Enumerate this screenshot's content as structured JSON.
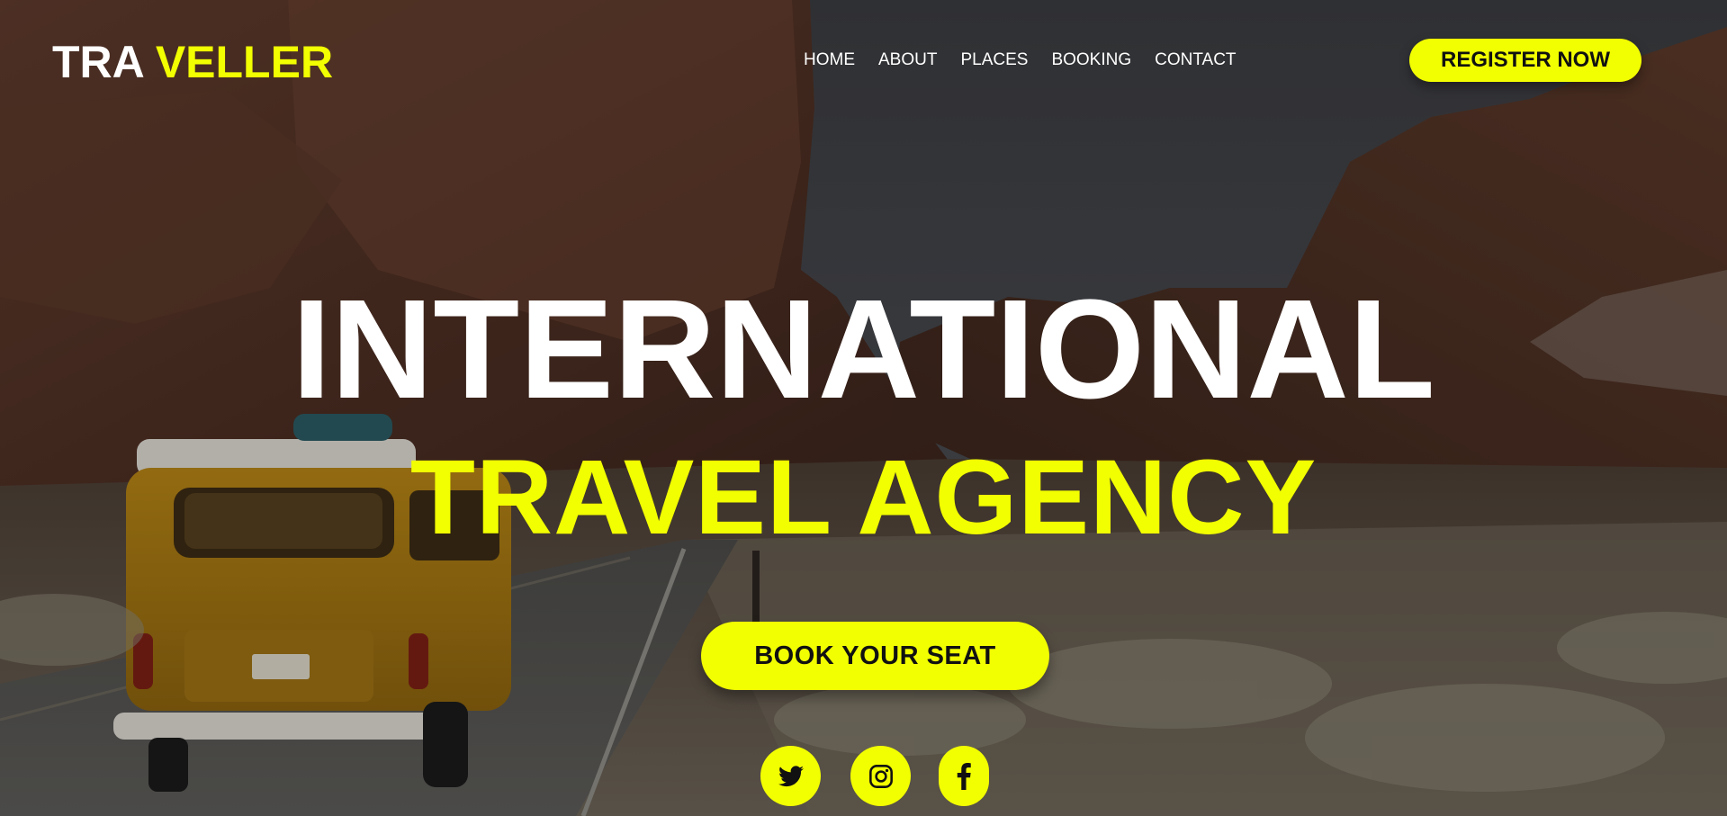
{
  "logo": {
    "part1": "TRA",
    "part2": "VELLER"
  },
  "nav": {
    "items": [
      {
        "label": "HOME"
      },
      {
        "label": "ABOUT"
      },
      {
        "label": "PLACES"
      },
      {
        "label": "BOOKING"
      },
      {
        "label": "CONTACT"
      }
    ]
  },
  "header": {
    "cta_label": "REGISTER NOW"
  },
  "hero": {
    "title_line1": "INTERNATIONAL",
    "title_line2": "TRAVEL AGENCY",
    "cta_label": "BOOK YOUR SEAT"
  },
  "social": {
    "icons": [
      "twitter-icon",
      "instagram-icon",
      "facebook-icon"
    ]
  },
  "colors": {
    "accent": "#f2ff00",
    "text": "#ffffff",
    "button_text": "#111111"
  }
}
